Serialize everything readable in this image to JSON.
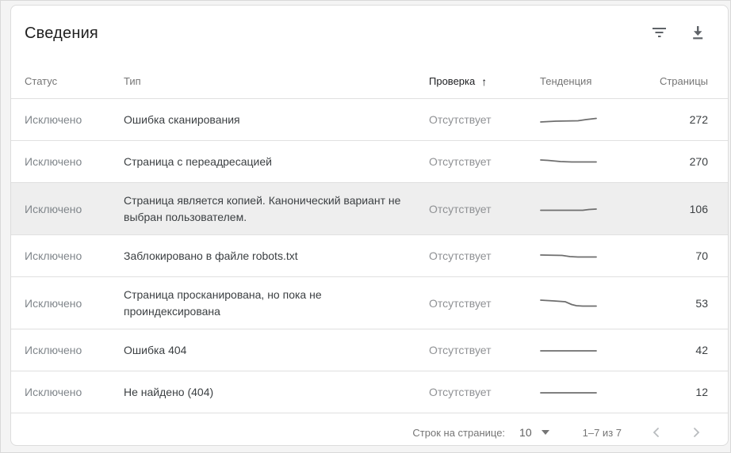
{
  "card": {
    "title": "Сведения",
    "toolbar": {
      "filter_icon": "filter-list",
      "download_icon": "download"
    }
  },
  "table": {
    "columns": {
      "status": "Статус",
      "type": "Тип",
      "validation": "Проверка",
      "trend": "Тенденция",
      "pages": "Страницы"
    },
    "sort": {
      "column": "validation",
      "direction": "asc",
      "arrow": "↑"
    },
    "rows": [
      {
        "status": "Исключено",
        "type": "Ошибка сканирования",
        "validation": "Отсутствует",
        "pages": "272",
        "highlighted": false,
        "trend_points": [
          [
            1,
            10
          ],
          [
            20,
            9
          ],
          [
            48,
            8.5
          ],
          [
            58,
            7
          ],
          [
            71,
            5.5
          ]
        ]
      },
      {
        "status": "Исключено",
        "type": "Страница с переадресацией",
        "validation": "Отсутствует",
        "pages": "270",
        "highlighted": false,
        "trend_points": [
          [
            1,
            5
          ],
          [
            10,
            5.5
          ],
          [
            26,
            7
          ],
          [
            40,
            7.5
          ],
          [
            71,
            7.5
          ]
        ]
      },
      {
        "status": "Исключено",
        "type": "Страница является копией. Канонический вариант не выбран пользователем.",
        "validation": "Отсутствует",
        "pages": "106",
        "highlighted": true,
        "trend_points": [
          [
            1,
            8.5
          ],
          [
            54,
            8.5
          ],
          [
            62,
            7.5
          ],
          [
            71,
            7
          ]
        ]
      },
      {
        "status": "Исключено",
        "type": "Заблокировано в файле robots.txt",
        "validation": "Отсутствует",
        "pages": "70",
        "highlighted": false,
        "trend_points": [
          [
            1,
            6
          ],
          [
            28,
            6.5
          ],
          [
            38,
            8
          ],
          [
            48,
            8.5
          ],
          [
            71,
            8.5
          ]
        ]
      },
      {
        "status": "Исключено",
        "type": "Страница просканирована, но пока не проиндексирована",
        "validation": "Отсутствует",
        "pages": "53",
        "highlighted": false,
        "trend_points": [
          [
            1,
            3
          ],
          [
            18,
            4
          ],
          [
            32,
            5
          ],
          [
            40,
            8.5
          ],
          [
            46,
            10
          ],
          [
            54,
            10.5
          ],
          [
            71,
            10.5
          ]
        ]
      },
      {
        "status": "Исключено",
        "type": "Ошибка 404",
        "validation": "Отсутствует",
        "pages": "42",
        "highlighted": false,
        "trend_points": [
          [
            1,
            8
          ],
          [
            71,
            8
          ]
        ]
      },
      {
        "status": "Исключено",
        "type": "Не найдено (404)",
        "validation": "Отсутствует",
        "pages": "12",
        "highlighted": false,
        "trend_points": [
          [
            1,
            8
          ],
          [
            71,
            8
          ]
        ]
      }
    ]
  },
  "footer": {
    "rows_per_page_label": "Строк на странице:",
    "rows_per_page_value": "10",
    "range_label": "1–7 из 7"
  },
  "colors": {
    "sparkline": "#6e6e6e",
    "row_highlight": "#eeeeee",
    "border": "#e0e0e0"
  }
}
